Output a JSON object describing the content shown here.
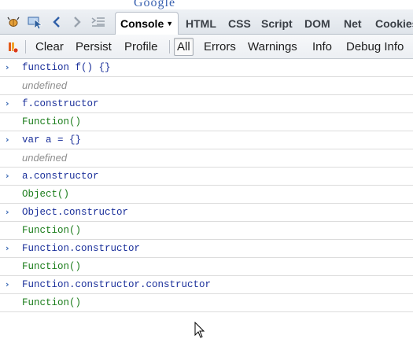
{
  "background_page": {
    "logo_fragment": "Google"
  },
  "tabbar": {
    "tabs": [
      {
        "label": "Console",
        "active": true
      },
      {
        "label": "HTML"
      },
      {
        "label": "CSS"
      },
      {
        "label": "Script"
      },
      {
        "label": "DOM"
      },
      {
        "label": "Net"
      },
      {
        "label": "Cookies"
      }
    ],
    "icons": [
      "firebug-icon",
      "inspect-icon",
      "back-icon",
      "forward-icon",
      "command-line-icon"
    ]
  },
  "toolbar": {
    "icon": "clear-console-icon",
    "buttons": [
      "Clear",
      "Persist",
      "Profile"
    ],
    "filters": [
      {
        "label": "All",
        "active": true
      },
      {
        "label": "Errors"
      },
      {
        "label": "Warnings"
      },
      {
        "label": "Info"
      },
      {
        "label": "Debug Info"
      }
    ]
  },
  "console_rows": [
    {
      "kind": "command",
      "text": "function f() {}"
    },
    {
      "kind": "undefined",
      "text": "undefined"
    },
    {
      "kind": "command",
      "text": "f.constructor"
    },
    {
      "kind": "result",
      "text": "Function()"
    },
    {
      "kind": "command",
      "text": "var a = {}"
    },
    {
      "kind": "undefined",
      "text": "undefined"
    },
    {
      "kind": "command",
      "text": "a.constructor"
    },
    {
      "kind": "result",
      "text": "Object()"
    },
    {
      "kind": "command",
      "text": "Object.constructor"
    },
    {
      "kind": "result",
      "text": "Function()"
    },
    {
      "kind": "command",
      "text": "Function.constructor"
    },
    {
      "kind": "result",
      "text": "Function()"
    },
    {
      "kind": "command",
      "text": "Function.constructor.constructor"
    },
    {
      "kind": "result",
      "text": "Function()"
    }
  ],
  "prompt_glyph": "›",
  "colors": {
    "command": "#1a2f9a",
    "result": "#1b7d1b",
    "undefined": "#8e8e8e",
    "prompt": "#3565b3"
  }
}
